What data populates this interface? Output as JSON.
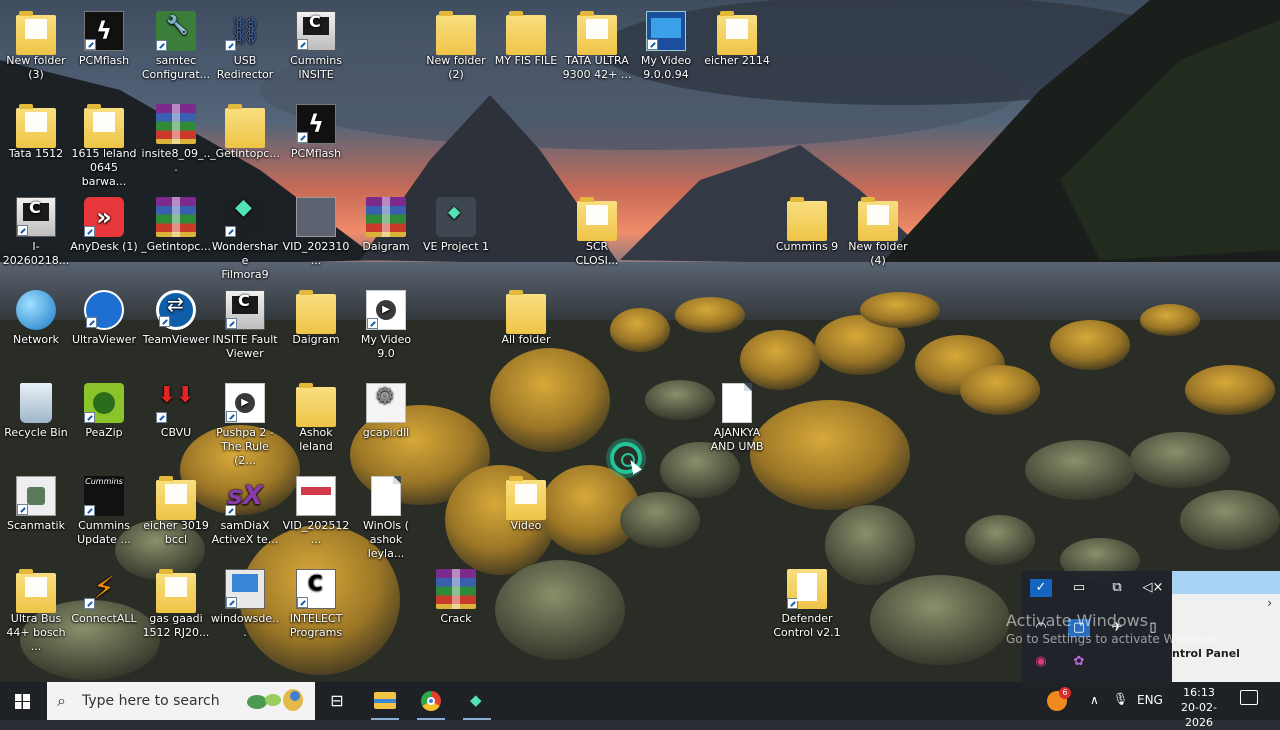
{
  "desktop": {
    "icons": [
      {
        "id": "new-folder-3",
        "label": "New folder\n(3)",
        "glyph": "folder-doc"
      },
      {
        "id": "pcmflash",
        "label": "PCMflash",
        "glyph": "black"
      },
      {
        "id": "samtec",
        "label": "samtec\nConfigurat...",
        "glyph": "samtec"
      },
      {
        "id": "usb-redirector",
        "label": "USB\nRedirector",
        "glyph": "usb"
      },
      {
        "id": "cummins-insite",
        "label": "Cummins\nINSITE",
        "glyph": "comp"
      },
      {
        "id": "new-folder-2",
        "label": "New folder\n(2)",
        "glyph": "folder"
      },
      {
        "id": "my-fis-file",
        "label": "MY FIS FILE",
        "glyph": "folder"
      },
      {
        "id": "tata-ultra",
        "label": "TATA ULTRA\n9300 42+ ...",
        "glyph": "folder-doc"
      },
      {
        "id": "my-video-9094",
        "label": "My Video\n9.0.0.94",
        "glyph": "video"
      },
      {
        "id": "eicher-2114",
        "label": "eicher 2114",
        "glyph": "folder-doc"
      },
      {
        "id": "tata-1512",
        "label": "Tata 1512",
        "glyph": "folder-doc"
      },
      {
        "id": "leland-1615",
        "label": "1615 leland\n0645 barwa...",
        "glyph": "folder-doc"
      },
      {
        "id": "insite8",
        "label": "insite8_09_...",
        "glyph": "rar-folder"
      },
      {
        "id": "getintopc-1",
        "label": "_Getintopc...",
        "glyph": "folder"
      },
      {
        "id": "pcmflash-2",
        "label": "PCMflash",
        "glyph": "black"
      },
      {
        "id": "i-20260218",
        "label": "I-20260218...",
        "glyph": "comp"
      },
      {
        "id": "anydesk",
        "label": "AnyDesk (1)",
        "glyph": "red"
      },
      {
        "id": "getintopc-2",
        "label": "_Getintopc...",
        "glyph": "rar"
      },
      {
        "id": "filmora9",
        "label": "Wondershare\nFilmora9",
        "glyph": "filmora"
      },
      {
        "id": "vid-202310",
        "label": "VID_202310...",
        "glyph": "vid"
      },
      {
        "id": "daigram-rar",
        "label": "Daigram",
        "glyph": "rar"
      },
      {
        "id": "ve-project",
        "label": "VE Project 1",
        "glyph": "gray"
      },
      {
        "id": "scr-closi",
        "label": "SCR\nCLOSI...",
        "glyph": "folder-doc"
      },
      {
        "id": "cummins-9",
        "label": "Cummins 9",
        "glyph": "folder"
      },
      {
        "id": "new-folder-4",
        "label": "New folder\n(4)",
        "glyph": "folder-doc"
      },
      {
        "id": "network",
        "label": "Network",
        "glyph": "globe"
      },
      {
        "id": "ultraviewer",
        "label": "UltraViewer",
        "glyph": "blue"
      },
      {
        "id": "teamviewer",
        "label": "TeamViewer",
        "glyph": "tv"
      },
      {
        "id": "insite-fault",
        "label": "INSITE Fault\nViewer",
        "glyph": "comp"
      },
      {
        "id": "daigram-folder",
        "label": "Daigram",
        "glyph": "folder"
      },
      {
        "id": "my-video-90",
        "label": "My Video 9.0",
        "glyph": "play"
      },
      {
        "id": "all-folder",
        "label": "All folder",
        "glyph": "folder"
      },
      {
        "id": "recycle-bin",
        "label": "Recycle Bin",
        "glyph": "bin"
      },
      {
        "id": "peazip",
        "label": "PeaZip",
        "glyph": "peazip"
      },
      {
        "id": "cbvu",
        "label": "CBVU",
        "glyph": "cbvu"
      },
      {
        "id": "pushpa2",
        "label": "Pushpa 2 -\nThe Rule (2...",
        "glyph": "play"
      },
      {
        "id": "ashok-leland",
        "label": "Ashok leland",
        "glyph": "folder"
      },
      {
        "id": "gcapi",
        "label": "gcapi.dll",
        "glyph": "gear"
      },
      {
        "id": "ajankya",
        "label": "AJANKYA\nAND UMB",
        "glyph": "doc"
      },
      {
        "id": "scanmatik",
        "label": "Scanmatik",
        "glyph": "scan"
      },
      {
        "id": "cummins-update",
        "label": "Cummins\nUpdate ...",
        "glyph": "cummins"
      },
      {
        "id": "eicher-3019",
        "label": "eicher 3019\nbccl",
        "glyph": "folder-doc"
      },
      {
        "id": "samdiax",
        "label": "samDiaX\nActiveX te...",
        "glyph": "sx"
      },
      {
        "id": "vid-202512",
        "label": "VID_202512...",
        "glyph": "shot"
      },
      {
        "id": "winols",
        "label": "WinOls (\nashok leyla...",
        "glyph": "doc"
      },
      {
        "id": "video-folder",
        "label": "Video",
        "glyph": "folder-doc"
      },
      {
        "id": "ultra-bus",
        "label": "Ultra Bus\n44+ bosch ...",
        "glyph": "folder-doc"
      },
      {
        "id": "connectall",
        "label": "ConnectALL",
        "glyph": "conn"
      },
      {
        "id": "gas-gaadi",
        "label": "gas gaadi\n1512 RJ20...",
        "glyph": "folder-doc"
      },
      {
        "id": "windowsde",
        "label": "windowsde...",
        "glyph": "wins"
      },
      {
        "id": "intelect",
        "label": "INTELECT\nPrograms",
        "glyph": "intelect"
      },
      {
        "id": "crack",
        "label": "Crack",
        "glyph": "rar"
      },
      {
        "id": "defender-control",
        "label": "Defender\nControl v2.1",
        "glyph": "def"
      }
    ]
  },
  "watermark": {
    "title": "Activate Windows",
    "subtitle": "Go to Settings to activate Windows."
  },
  "flyout": {
    "panel_title": "ntrol Panel",
    "chevron": "›"
  },
  "taskbar": {
    "search_placeholder": "Type here to search",
    "language": "ENG",
    "time": "16:13",
    "date": "20-02-2026",
    "notification_badge": "6",
    "apps": [
      "File Explorer",
      "Google Chrome",
      "Wondershare Filmora9"
    ]
  }
}
